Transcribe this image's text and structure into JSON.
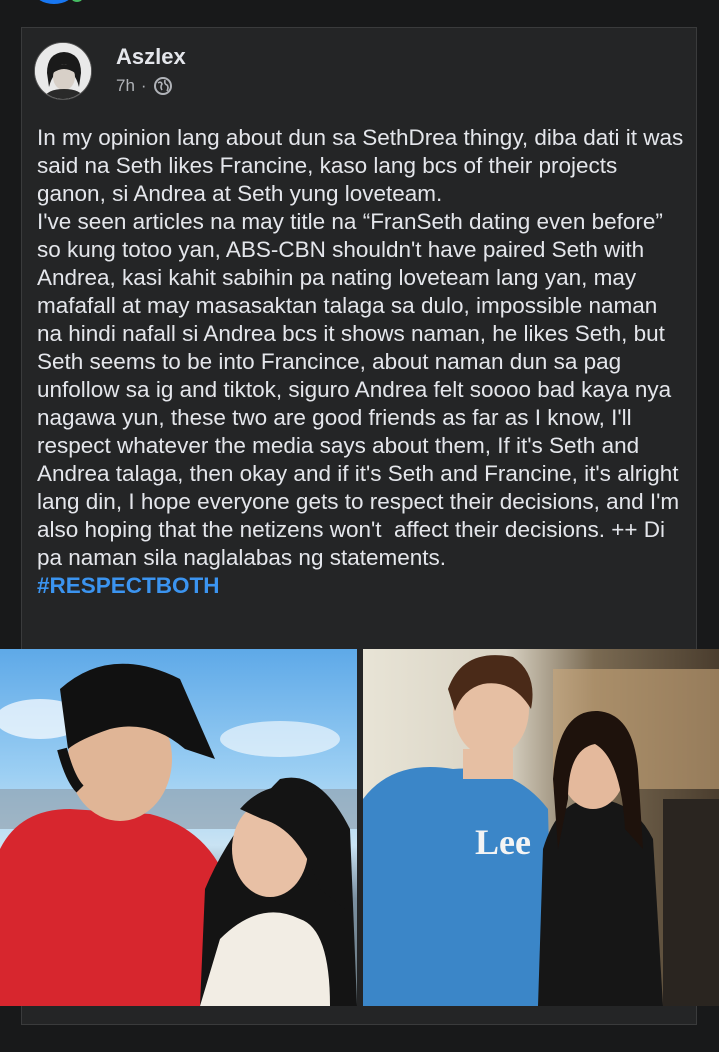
{
  "post": {
    "author": "Aszlex",
    "timestamp": "7h",
    "separator": "·",
    "privacy_icon": "globe-icon",
    "body": "In my opinion lang about dun sa SethDrea thingy, diba dati it was said na Seth likes Francine, kaso lang bcs of their projects ganon, si Andrea at Seth yung loveteam.\nI've seen articles na may title na “FranSeth dating even before” so kung totoo yan, ABS-CBN shouldn't have paired Seth with Andrea, kasi kahit sabihin pa nating loveteam lang yan, may mafafall at may masasaktan talaga sa dulo, impossible naman na hindi nafall si Andrea bcs it shows naman, he likes Seth, but Seth seems to be into Francince, about naman dun sa pag unfollow sa ig and tiktok, siguro Andrea felt soooo bad kaya nya nagawa yun, these two are good friends as far as I know, I'll respect whatever the media says about them, If it's Seth and Andrea talaga, then okay and if it's Seth and Francine, it's alright lang din, I hope everyone gets to respect their decisions, and I'm also hoping that the netizens won't  affect their decisions. ++ Di pa naman sila naglalabas ng statements.",
    "hashtag": "#RESPECTBOTH"
  },
  "photos": {
    "left": {
      "shirt_text": ""
    },
    "right": {
      "shirt_text": "Lee"
    }
  },
  "colors": {
    "background": "#18191a",
    "card": "#242526",
    "text": "#e4e6eb",
    "meta": "#b0b3b8",
    "hashtag": "#3b94f0"
  }
}
